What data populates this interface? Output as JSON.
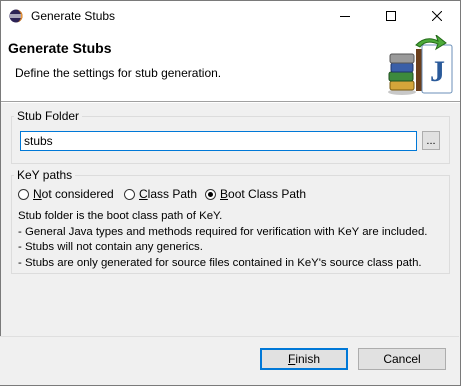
{
  "window": {
    "title": "Generate Stubs"
  },
  "banner": {
    "title": "Generate Stubs",
    "description": "Define the settings for stub generation."
  },
  "stub_folder": {
    "label": "Stub Folder",
    "value": "stubs",
    "browse_label": "..."
  },
  "key_paths": {
    "label": "KeY paths",
    "options": [
      {
        "mnemonic": "N",
        "rest": "ot considered",
        "selected": false
      },
      {
        "mnemonic": "C",
        "rest": "lass Path",
        "selected": false
      },
      {
        "mnemonic": "B",
        "rest": "oot Class Path",
        "selected": true
      }
    ],
    "info_lines": [
      "Stub folder is the boot class path of KeY.",
      "- General Java types and methods required for verification with KeY are included.",
      "- Stubs will not contain any generics.",
      "- Stubs are only generated for source files contained in KeY's source class path."
    ]
  },
  "buttons": {
    "finish_mnemonic": "F",
    "finish_rest": "inish",
    "cancel": "Cancel"
  },
  "colors": {
    "accent": "#0078d7",
    "title_bg": "#ffffff",
    "dialog_bg": "#f0f0f0"
  }
}
